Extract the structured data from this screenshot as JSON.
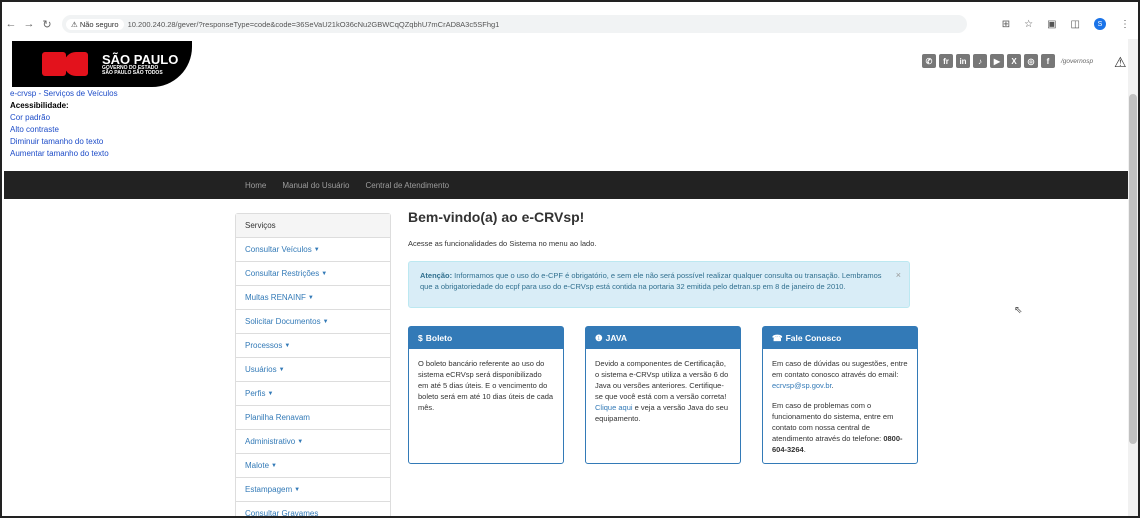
{
  "browser": {
    "not_secure": "Não seguro",
    "url": "10.200.240.28/gever/?responseType=code&code=36SeVaU21kO36cNu2GBWCqQZqbhU7mCrAD8A3c5SFhg1",
    "profile_initial": "S"
  },
  "header": {
    "logo_title": "SÃO PAULO",
    "logo_sub1": "GOVERNO DO ESTADO",
    "logo_sub2": "SÃO PAULO SÃO TODOS",
    "social_handle": "/governosp",
    "social_icons": [
      "whatsapp-icon",
      "flickr-icon",
      "linkedin-icon",
      "tiktok-icon",
      "youtube-icon",
      "x-icon",
      "instagram-icon",
      "facebook-icon"
    ]
  },
  "accessibility": {
    "site_link": "e-crvsp - Serviços de Veículos",
    "title": "Acessibilidade:",
    "links": [
      "Cor padrão",
      "Alto contraste",
      "Diminuir tamanho do texto",
      "Aumentar tamanho do texto"
    ]
  },
  "nav": [
    "Home",
    "Manual do Usuário",
    "Central de Atendimento"
  ],
  "sidebar": {
    "header": "Serviços",
    "items": [
      "Consultar Veículos",
      "Consultar Restrições",
      "Multas RENAINF",
      "Solicitar Documentos",
      "Processos",
      "Usuários",
      "Perfis",
      "Planilha Renavam",
      "Administrativo",
      "Malote",
      "Estampagem",
      "Consultar Gravames"
    ],
    "dropdown": [
      true,
      true,
      true,
      true,
      true,
      true,
      true,
      false,
      true,
      true,
      true,
      false
    ]
  },
  "main": {
    "title": "Bem-vindo(a) ao e-CRVsp!",
    "intro": "Acesse as funcionalidades do Sistema no menu ao lado.",
    "alert_strong": "Atenção:",
    "alert_text": " Informamos que o uso do e-CPF é obrigatório, e sem ele não será possível realizar qualquer consulta ou transação. Lembramos que a obrigatoriedade do ecpf para uso do e-CRVsp está contida na portaria 32 emitida pelo detran.sp em 8 de janeiro de 2010.",
    "alert_close": "×"
  },
  "panels": {
    "boleto": {
      "title": "Boleto",
      "icon": "dollar-icon",
      "body": "O boleto bancário referente ao uso do sistema eCRVsp será disponibilizado em até 5 dias úteis. E o vencimento do boleto será em até 10 dias úteis de cada mês."
    },
    "java": {
      "title": "JAVA",
      "icon": "info-icon",
      "body_pre": "Devido a componentes de Certificação, o sistema e-CRVsp utiliza a versão 6 do Java ou versões anteriores. Certifique-se que você está com a versão correta! ",
      "link": "Clique aqui",
      "body_post": " e veja a versão Java do seu equipamento."
    },
    "contato": {
      "title": "Fale Conosco",
      "icon": "phone-icon",
      "p1_pre": "Em caso de dúvidas ou sugestões, entre em contato conosco através do email: ",
      "email": "ecrvsp@sp.gov.br",
      "p1_post": ".",
      "p2_pre": "Em caso de problemas com o funcionamento do sistema, entre em contato com nossa central de atendimento através do telefone: ",
      "phone": "0800-604-3264",
      "p2_post": "."
    }
  }
}
